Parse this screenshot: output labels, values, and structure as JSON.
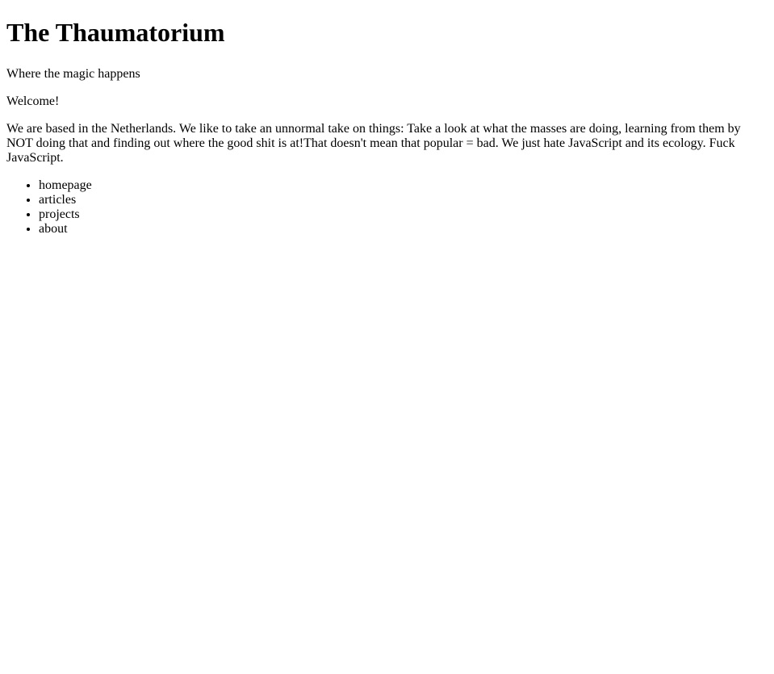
{
  "header": {
    "title": "The Thaumatorium",
    "tagline": "Where the magic happens"
  },
  "main": {
    "greeting": "Welcome!",
    "intro": "We are based in the Netherlands. We like to take an unnormal take on things: Take a look at what the masses are doing, learning from them by NOT doing that and finding out where the good shit is at!That doesn't mean that popular = bad. We just hate JavaScript and its ecology. Fuck JavaScript."
  },
  "nav": {
    "items": [
      {
        "label": "homepage"
      },
      {
        "label": "articles"
      },
      {
        "label": "projects"
      },
      {
        "label": "about"
      }
    ]
  }
}
